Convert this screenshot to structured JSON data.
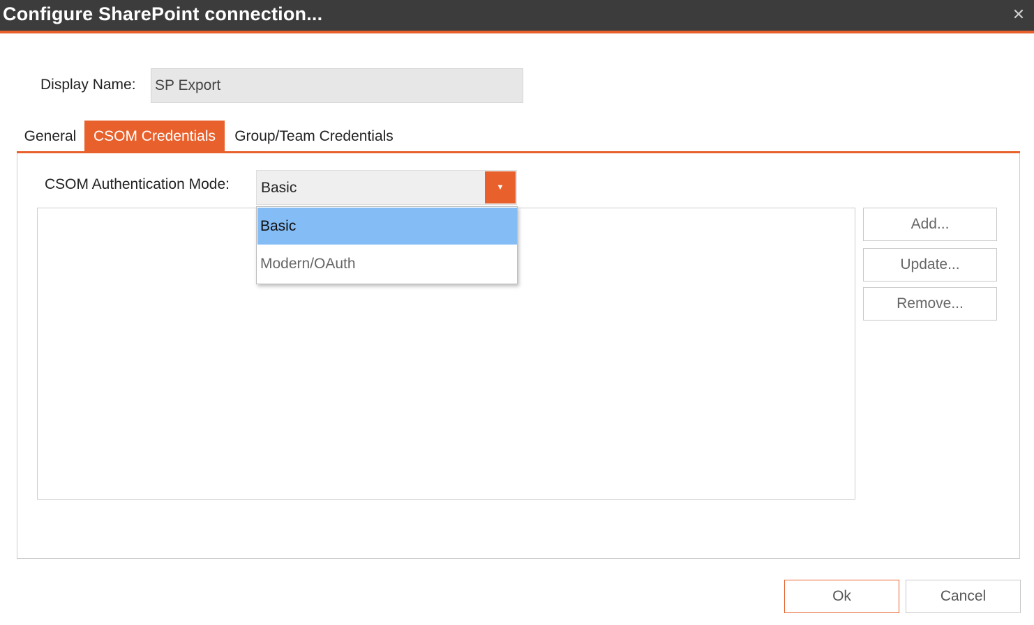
{
  "window": {
    "title": "Configure SharePoint connection...",
    "close_glyph": "✕"
  },
  "display_name": {
    "label": "Display Name:",
    "value": "SP Export"
  },
  "tabs": [
    {
      "label": "General",
      "active": false
    },
    {
      "label": "CSOM Credentials",
      "active": true
    },
    {
      "label": "Group/Team Credentials",
      "active": false
    }
  ],
  "csom": {
    "auth_mode_label": "CSOM Authentication Mode:",
    "auth_mode_value": "Basic",
    "dropdown_arrow": "▼",
    "options": [
      {
        "label": "Basic",
        "selected": true
      },
      {
        "label": "Modern/OAuth",
        "selected": false
      }
    ],
    "buttons": {
      "add": "Add...",
      "update": "Update...",
      "remove": "Remove..."
    }
  },
  "footer": {
    "ok": "Ok",
    "cancel": "Cancel"
  },
  "colors": {
    "accent": "#e8612c",
    "titlebar": "#3c3c3c",
    "selection": "#84bdf6"
  }
}
